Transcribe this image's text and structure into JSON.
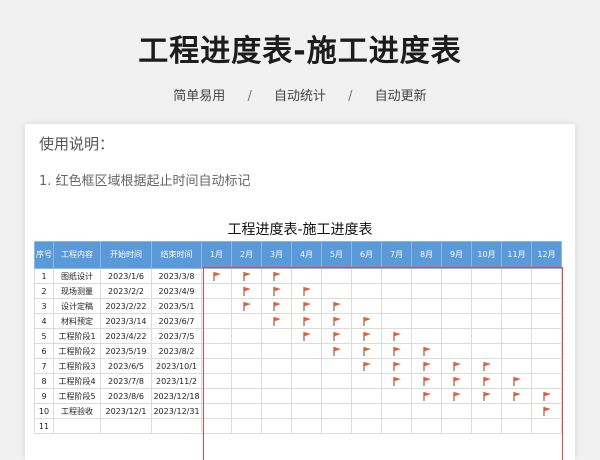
{
  "title": "工程进度表-施工进度表",
  "subtitle": {
    "items": [
      "简单易用",
      "自动统计",
      "自动更新"
    ],
    "separator": "/"
  },
  "instructions": {
    "heading": "使用说明：",
    "line1": "1. 红色框区域根据起止时间自动标记"
  },
  "sheet": {
    "title": "工程进度表-施工进度表",
    "headers": {
      "seq": "序号",
      "task": "工程内容",
      "start": "开始时间",
      "end": "结束时间",
      "months": [
        "1月",
        "2月",
        "3月",
        "4月",
        "5月",
        "6月",
        "7月",
        "8月",
        "9月",
        "10月",
        "11月",
        "12月"
      ]
    },
    "rows": [
      {
        "no": "1",
        "task": "图纸设计",
        "start": "2023/1/6",
        "end": "2023/3/8",
        "flags": [
          1,
          2,
          3
        ]
      },
      {
        "no": "2",
        "task": "现场测量",
        "start": "2023/2/2",
        "end": "2023/4/9",
        "flags": [
          2,
          3,
          4
        ]
      },
      {
        "no": "3",
        "task": "设计定稿",
        "start": "2023/2/22",
        "end": "2023/5/1",
        "flags": [
          2,
          3,
          4,
          5
        ]
      },
      {
        "no": "4",
        "task": "材料预定",
        "start": "2023/3/14",
        "end": "2023/6/7",
        "flags": [
          3,
          4,
          5,
          6
        ]
      },
      {
        "no": "5",
        "task": "工程阶段1",
        "start": "2023/4/22",
        "end": "2023/7/5",
        "flags": [
          4,
          5,
          6,
          7
        ]
      },
      {
        "no": "6",
        "task": "工程阶段2",
        "start": "2023/5/19",
        "end": "2023/8/2",
        "flags": [
          5,
          6,
          7,
          8
        ]
      },
      {
        "no": "7",
        "task": "工程阶段3",
        "start": "2023/6/5",
        "end": "2023/10/1",
        "flags": [
          6,
          7,
          8,
          9,
          10
        ]
      },
      {
        "no": "8",
        "task": "工程阶段4",
        "start": "2023/7/8",
        "end": "2023/11/2",
        "flags": [
          7,
          8,
          9,
          10,
          11
        ]
      },
      {
        "no": "9",
        "task": "工程阶段5",
        "start": "2023/8/6",
        "end": "2023/12/18",
        "flags": [
          8,
          9,
          10,
          11,
          12
        ]
      },
      {
        "no": "10",
        "task": "工程验收",
        "start": "2023/12/1",
        "end": "2023/12/31",
        "flags": [
          12
        ]
      },
      {
        "no": "11",
        "task": "",
        "start": "",
        "end": "",
        "flags": []
      }
    ]
  },
  "colors": {
    "header_bg": "#5a9ad8",
    "frame": "#e0454a",
    "flag": "#e0623a"
  },
  "icons": {
    "flag": "flag-icon"
  }
}
